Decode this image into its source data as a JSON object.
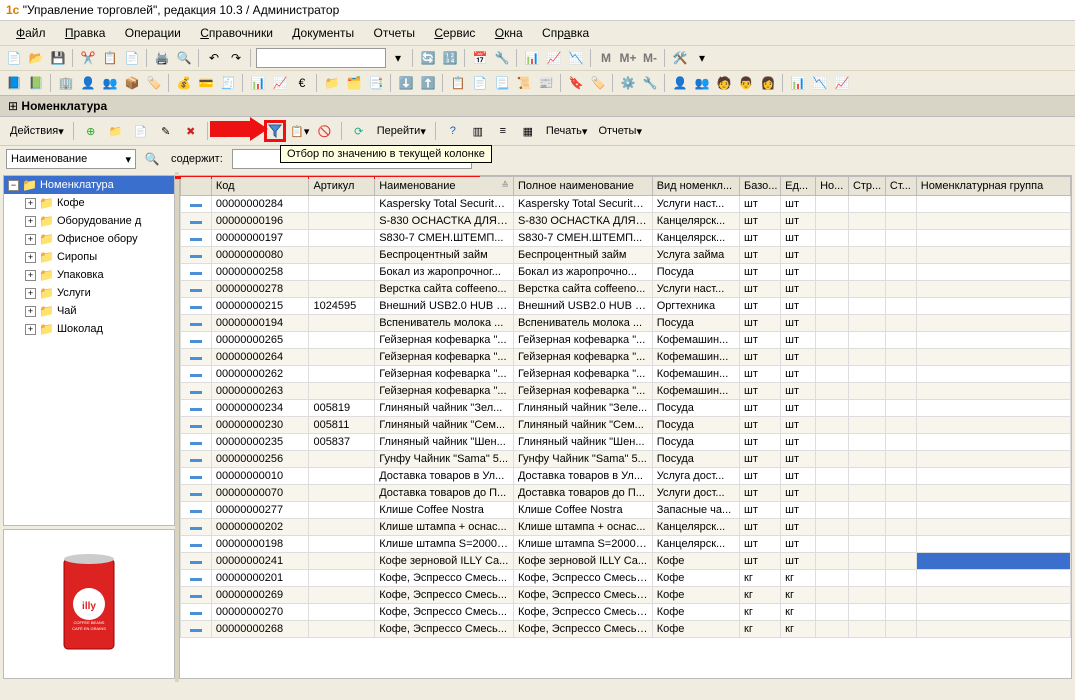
{
  "title": "\"Управление торговлей\", редакция 10.3 / Администратор",
  "menu": [
    "Файл",
    "Правка",
    "Операции",
    "Справочники",
    "Документы",
    "Отчеты",
    "Сервис",
    "Окна",
    "Справка"
  ],
  "panel_title": "Номенклатура",
  "actions_label": "Действия",
  "goto_label": "Перейти",
  "print_label": "Печать",
  "reports_label": "Отчеты",
  "tooltip": "Отбор по значению в текущей колонке",
  "filter": {
    "field": "Наименование",
    "contains_label": "содержит:",
    "value": ""
  },
  "tree": {
    "root": "Номенклатура",
    "items": [
      "Кофе",
      "Оборудование д",
      "Офисное обору",
      "Сиропы",
      "Упаковка",
      "Услуги",
      "Чай",
      "Шоколад"
    ]
  },
  "columns": [
    "",
    "Код",
    "Артикул",
    "Наименование",
    "Полное наименование",
    "Вид номенкл...",
    "Базо...",
    "Ед...",
    "Но...",
    "Стр...",
    "Ст...",
    "Номенклатурная группа"
  ],
  "rows": [
    {
      "code": "00000000284",
      "art": "",
      "name": "Kaspersky Total Security ...",
      "full": "Kaspersky Total Security ...",
      "type": "Услуги наст...",
      "base": "шт",
      "unit": "шт"
    },
    {
      "code": "00000000196",
      "art": "",
      "name": "S-830 ОСНАСТКА ДЛЯ ...",
      "full": "S-830 ОСНАСТКА ДЛЯ ...",
      "type": "Канцелярск...",
      "base": "шт",
      "unit": "шт"
    },
    {
      "code": "00000000197",
      "art": "",
      "name": "S830-7 СМЕН.ШТЕМП...",
      "full": "S830-7 СМЕН.ШТЕМП...",
      "type": "Канцелярск...",
      "base": "шт",
      "unit": "шт"
    },
    {
      "code": "00000000080",
      "art": "",
      "name": "Беспроцентный займ",
      "full": "Беспроцентный займ",
      "type": "Услуга займа",
      "base": "шт",
      "unit": "шт"
    },
    {
      "code": "00000000258",
      "art": "",
      "name": "Бокал из жаропрочног...",
      "full": "Бокал из жаропрочно...",
      "type": "Посуда",
      "base": "шт",
      "unit": "шт"
    },
    {
      "code": "00000000278",
      "art": "",
      "name": "Верстка сайта coffeeno...",
      "full": "Верстка сайта coffeeno...",
      "type": "Услуги наст...",
      "base": "шт",
      "unit": "шт"
    },
    {
      "code": "00000000215",
      "art": "1024595",
      "name": "Внешний USB2.0 HUB 7...",
      "full": "Внешний USB2.0 HUB 7...",
      "type": "Оргтехника",
      "base": "шт",
      "unit": "шт"
    },
    {
      "code": "00000000194",
      "art": "",
      "name": "Вспениватель молока ...",
      "full": "Вспениватель молока ...",
      "type": "Посуда",
      "base": "шт",
      "unit": "шт"
    },
    {
      "code": "00000000265",
      "art": "",
      "name": "Гейзерная кофеварка \"...",
      "full": "Гейзерная кофеварка \"...",
      "type": "Кофемашин...",
      "base": "шт",
      "unit": "шт"
    },
    {
      "code": "00000000264",
      "art": "",
      "name": "Гейзерная кофеварка \"...",
      "full": "Гейзерная кофеварка \"...",
      "type": "Кофемашин...",
      "base": "шт",
      "unit": "шт"
    },
    {
      "code": "00000000262",
      "art": "",
      "name": "Гейзерная кофеварка \"...",
      "full": "Гейзерная кофеварка \"...",
      "type": "Кофемашин...",
      "base": "шт",
      "unit": "шт"
    },
    {
      "code": "00000000263",
      "art": "",
      "name": "Гейзерная кофеварка \"...",
      "full": "Гейзерная кофеварка \"...",
      "type": "Кофемашин...",
      "base": "шт",
      "unit": "шт"
    },
    {
      "code": "00000000234",
      "art": "005819",
      "name": "Глиняный чайник \"Зел...",
      "full": "Глиняный чайник \"Зеле...",
      "type": "Посуда",
      "base": "шт",
      "unit": "шт"
    },
    {
      "code": "00000000230",
      "art": "005811",
      "name": "Глиняный чайник \"Сем...",
      "full": "Глиняный чайник \"Сем...",
      "type": "Посуда",
      "base": "шт",
      "unit": "шт"
    },
    {
      "code": "00000000235",
      "art": "005837",
      "name": "Глиняный чайник \"Шен...",
      "full": "Глиняный чайник \"Шен...",
      "type": "Посуда",
      "base": "шт",
      "unit": "шт"
    },
    {
      "code": "00000000256",
      "art": "",
      "name": "Гунфу Чайник \"Sama\" 5...",
      "full": "Гунфу Чайник \"Sama\" 5...",
      "type": "Посуда",
      "base": "шт",
      "unit": "шт"
    },
    {
      "code": "00000000010",
      "art": "",
      "name": "Доставка товаров в Ул...",
      "full": "Доставка товаров в Ул...",
      "type": "Услуга дост...",
      "base": "шт",
      "unit": "шт"
    },
    {
      "code": "00000000070",
      "art": "",
      "name": "Доставка товаров до П...",
      "full": "Доставка товаров до П...",
      "type": "Услуги дост...",
      "base": "шт",
      "unit": "шт"
    },
    {
      "code": "00000000277",
      "art": "",
      "name": "Клише Coffee Nostra",
      "full": "Клише Coffee Nostra",
      "type": "Запасные ча...",
      "base": "шт",
      "unit": "шт"
    },
    {
      "code": "00000000202",
      "art": "",
      "name": "Клише штампа + оснас...",
      "full": "Клише штампа + оснас...",
      "type": "Канцелярск...",
      "base": "шт",
      "unit": "шт"
    },
    {
      "code": "00000000198",
      "art": "",
      "name": "Клише штампа S=2000-...",
      "full": "Клише штампа S=2000-...",
      "type": "Канцелярск...",
      "base": "шт",
      "unit": "шт"
    },
    {
      "code": "00000000241",
      "art": "",
      "name": "Кофе зерновой ILLY Ca...",
      "full": "Кофе зерновой ILLY Ca...",
      "type": "Кофе",
      "base": "шт",
      "unit": "шт",
      "sel": true
    },
    {
      "code": "00000000201",
      "art": "",
      "name": "Кофе, Эспрессо Смесь...",
      "full": "Кофе, Эспрессо Смесь ...",
      "type": "Кофе",
      "base": "кг",
      "unit": "кг"
    },
    {
      "code": "00000000269",
      "art": "",
      "name": "Кофе, Эспрессо Смесь...",
      "full": "Кофе, Эспрессо Смесь ...",
      "type": "Кофе",
      "base": "кг",
      "unit": "кг"
    },
    {
      "code": "00000000270",
      "art": "",
      "name": "Кофе, Эспрессо Смесь...",
      "full": "Кофе, Эспрессо Смесь ...",
      "type": "Кофе",
      "base": "кг",
      "unit": "кг"
    },
    {
      "code": "00000000268",
      "art": "",
      "name": "Кофе, Эспрессо Смесь...",
      "full": "Кофе, Эспрессо Смесь ...",
      "type": "Кофе",
      "base": "кг",
      "unit": "кг"
    }
  ]
}
